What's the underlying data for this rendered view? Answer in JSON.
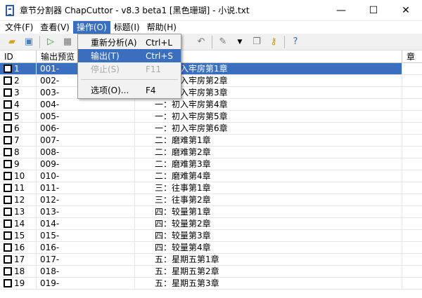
{
  "window": {
    "title": "章节分割器 ChapCuttor - v8.3 beta1 [黑色珊瑚] - 小说.txt",
    "minimize": "—",
    "maximize": "☐",
    "close": "✕"
  },
  "menubar": [
    "文件(F)",
    "查看(V)",
    "操作(O)",
    "标题(I)",
    "帮助(H)"
  ],
  "dropdown": [
    {
      "label": "重新分析(A)",
      "shortcut": "Ctrl+L",
      "state": "normal"
    },
    {
      "label": "输出(T)",
      "shortcut": "Ctrl+S",
      "state": "highlighted"
    },
    {
      "label": "停止(S)",
      "shortcut": "F11",
      "state": "disabled"
    },
    {
      "label": "选项(O)...",
      "shortcut": "F4",
      "state": "normal"
    }
  ],
  "columns": {
    "id": "ID",
    "preview": "输出预览",
    "extra": "章"
  },
  "rows": [
    {
      "id": "1",
      "preview": "001-",
      "title": "一：初入牢房第1章"
    },
    {
      "id": "2",
      "preview": "002-",
      "title": "一：初入牢房第2章"
    },
    {
      "id": "3",
      "preview": "003-",
      "title": "一：初入牢房第3章"
    },
    {
      "id": "4",
      "preview": "004-",
      "title": "一：初入牢房第4章"
    },
    {
      "id": "5",
      "preview": "005-",
      "title": "一：初入牢房第5章"
    },
    {
      "id": "6",
      "preview": "006-",
      "title": "一：初入牢房第6章"
    },
    {
      "id": "7",
      "preview": "007-",
      "title": "二：磨难第1章"
    },
    {
      "id": "8",
      "preview": "008-",
      "title": "二：磨难第2章"
    },
    {
      "id": "9",
      "preview": "009-",
      "title": "二：磨难第3章"
    },
    {
      "id": "10",
      "preview": "010-",
      "title": "二：磨难第4章"
    },
    {
      "id": "11",
      "preview": "011-",
      "title": "三：往事第1章"
    },
    {
      "id": "12",
      "preview": "012-",
      "title": "三：往事第2章"
    },
    {
      "id": "13",
      "preview": "013-",
      "title": "四：较量第1章"
    },
    {
      "id": "14",
      "preview": "014-",
      "title": "四：较量第2章"
    },
    {
      "id": "15",
      "preview": "015-",
      "title": "四：较量第3章"
    },
    {
      "id": "16",
      "preview": "016-",
      "title": "四：较量第4章"
    },
    {
      "id": "17",
      "preview": "017-",
      "title": "五：星期五第1章"
    },
    {
      "id": "18",
      "preview": "018-",
      "title": "五：星期五第2章"
    },
    {
      "id": "19",
      "preview": "019-",
      "title": "五：星期五第3章"
    }
  ],
  "selected_row": 0
}
